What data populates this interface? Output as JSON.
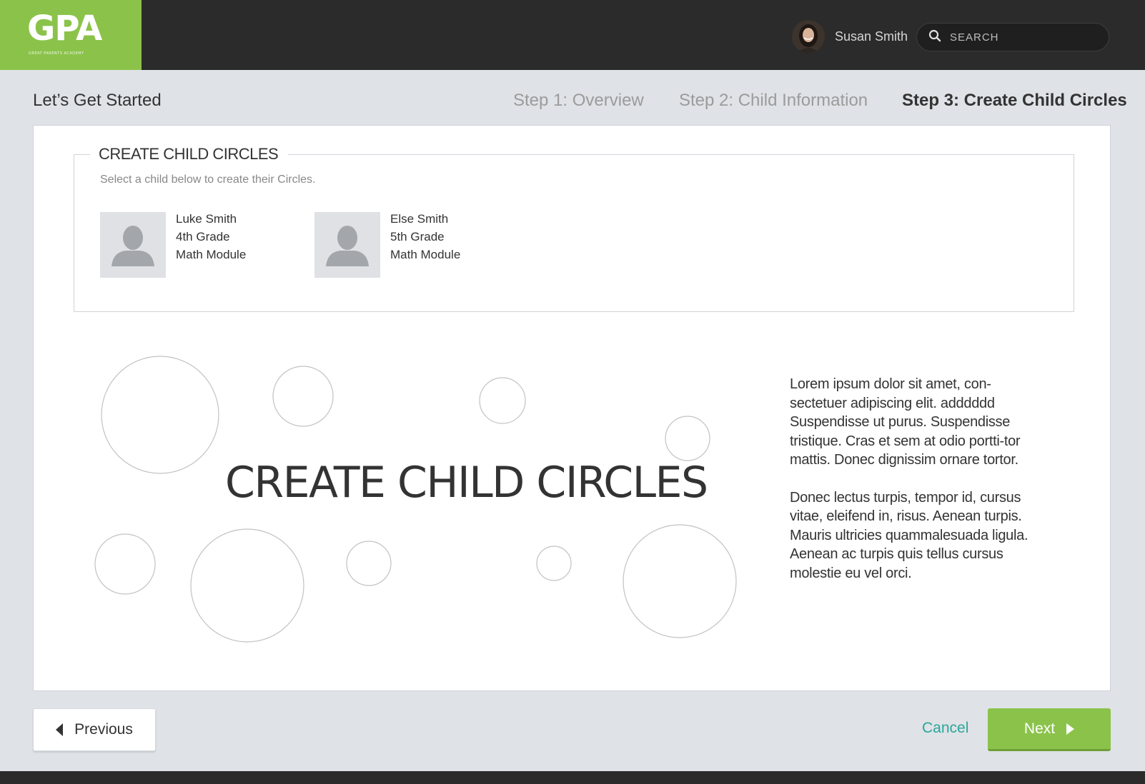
{
  "brand": {
    "logo": "GPA",
    "tagline": "Great Parents Academy",
    "accent": "#8bc34a"
  },
  "header": {
    "user_name": "Susan Smith",
    "search_placeholder": "SEARCH"
  },
  "wizard": {
    "title": "Let’s Get Started",
    "steps": [
      {
        "label": "Step 1: Overview",
        "active": false
      },
      {
        "label": "Step 2: Child Information",
        "active": false
      },
      {
        "label": "Step 3: Create Child Circles",
        "active": true
      }
    ]
  },
  "section": {
    "legend": "CREATE CHILD CIRCLES",
    "help": "Select a child below to create their Circles.",
    "children": [
      {
        "name": "Luke Smith",
        "grade": "4th Grade",
        "module": "Math Module"
      },
      {
        "name": "Else Smith",
        "grade": "5th Grade",
        "module": "Math Module"
      }
    ]
  },
  "hero": {
    "title": "CREATE CHILD CIRCLES",
    "paragraphs": [
      "Lorem ipsum dolor sit amet, con-sectetuer adipiscing elit. adddddd Suspendisse ut purus. Suspendisse tristique. Cras et sem at odio portti-tor mattis. Donec dignissim ornare tortor.",
      "Donec lectus turpis, tempor id, cursus vitae, eleifend in, risus. Aenean turpis. Mauris ultricies quammalesuada ligula. Aenean ac turpis quis tellus cursus molestie eu vel orci."
    ]
  },
  "footer": {
    "previous_label": "Previous",
    "cancel_label": "Cancel",
    "next_label": "Next",
    "cancel_color": "#2aa79b"
  },
  "icons": [
    "search-icon",
    "person-icon",
    "caret-left-icon",
    "caret-right-icon"
  ]
}
